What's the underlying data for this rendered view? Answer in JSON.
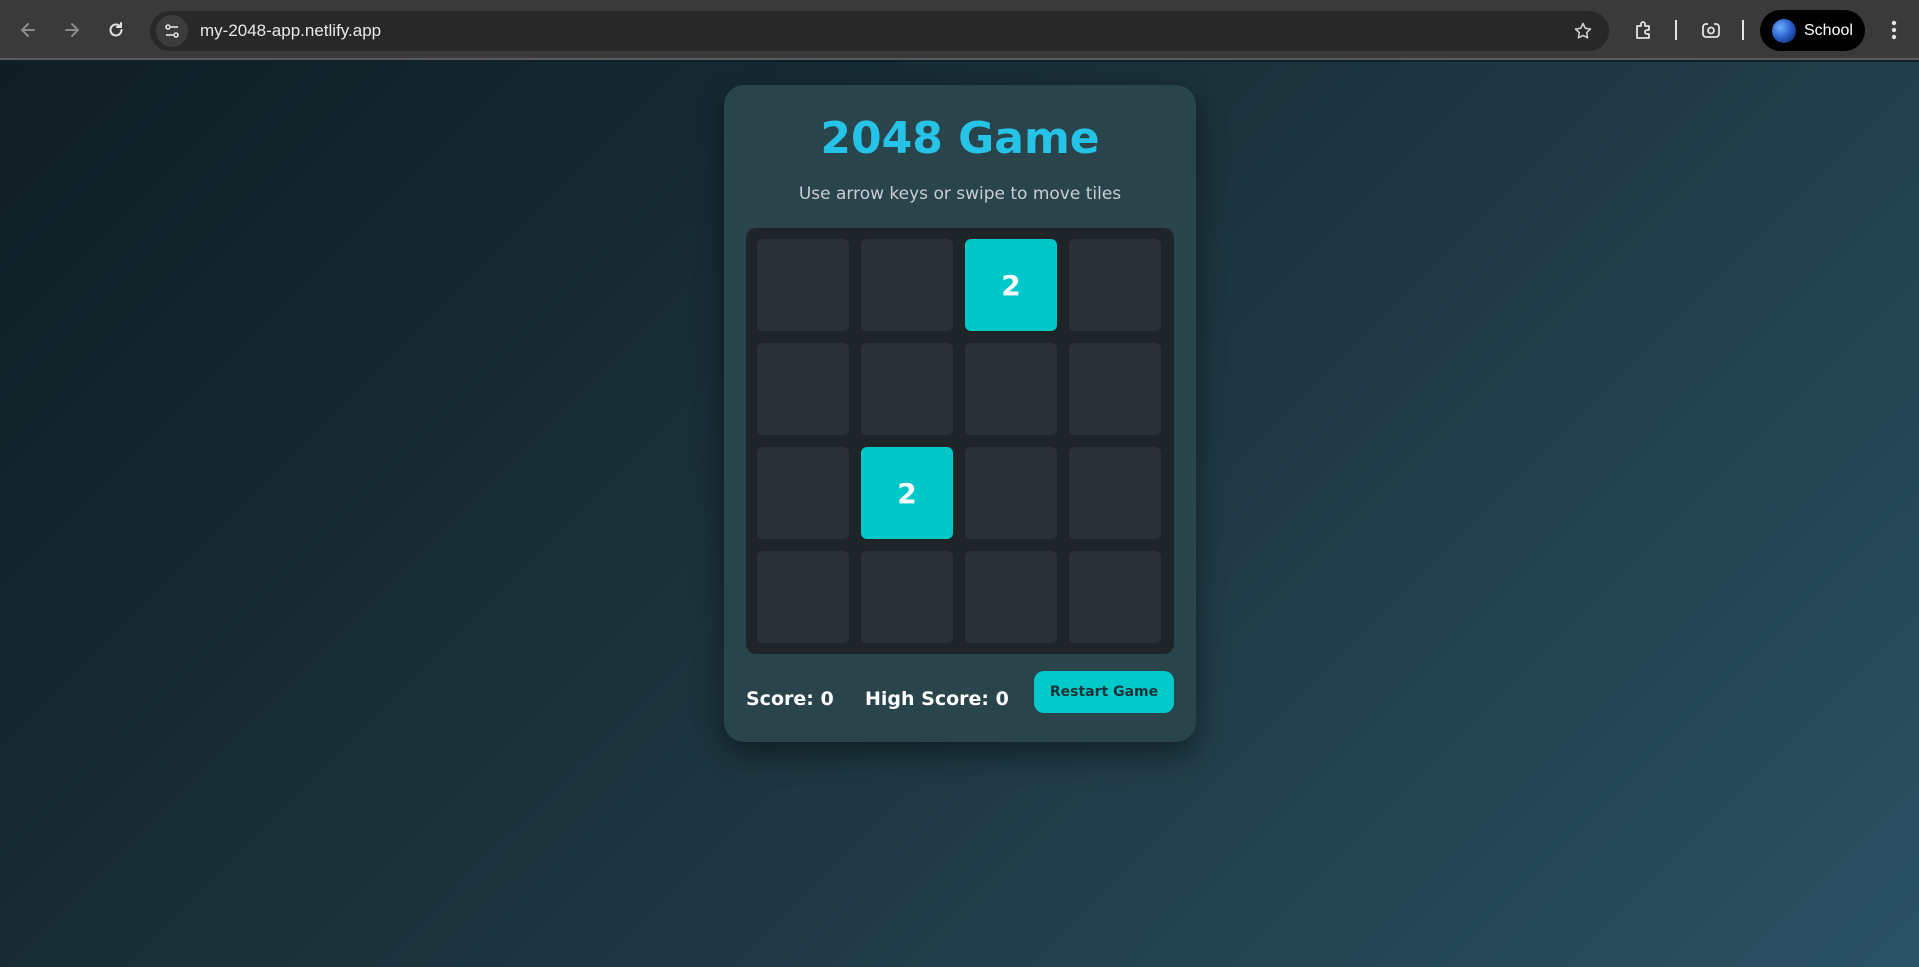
{
  "browser": {
    "url": "my-2048-app.netlify.app",
    "profile_name": "School"
  },
  "game": {
    "title": "2048 Game",
    "subtitle": "Use arrow keys or swipe to move tiles",
    "board": [
      [
        "",
        "",
        "2",
        ""
      ],
      [
        "",
        "",
        "",
        ""
      ],
      [
        "",
        "2",
        "",
        ""
      ],
      [
        "",
        "",
        "",
        ""
      ]
    ],
    "score_text": "Score: 0",
    "high_score_text": "High Score: 0",
    "restart_label": "Restart Game"
  },
  "colors": {
    "title": "#25c3e8",
    "tile_2": "#00c8c8",
    "tile_empty": "#2c3137",
    "button": "#00c9c9"
  },
  "icons": {
    "back": "arrow-left-icon",
    "forward": "arrow-right-icon",
    "reload": "reload-icon",
    "site_info": "tune-icon",
    "bookmark": "star-icon",
    "extensions": "puzzle-icon",
    "lens": "lens-icon",
    "menu": "kebab-menu-icon"
  }
}
